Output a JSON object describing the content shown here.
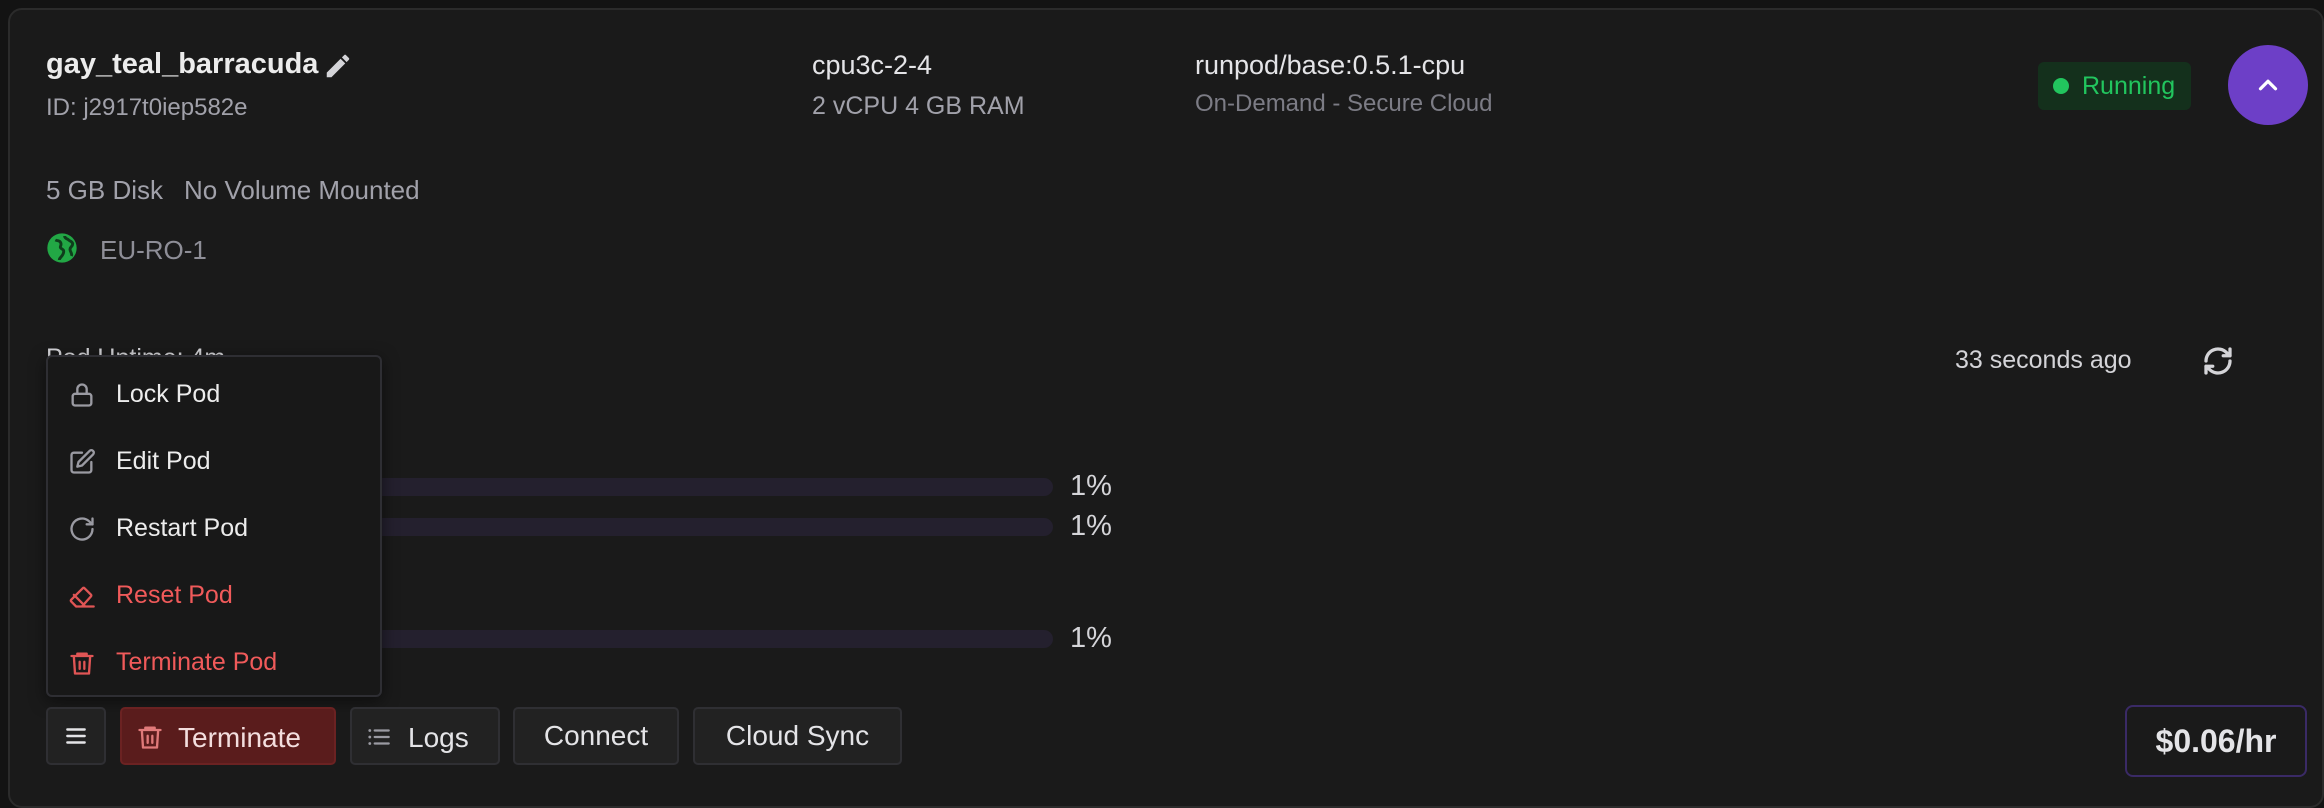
{
  "pod": {
    "name": "gay_teal_barracuda",
    "id_label": "ID: j2917t0iep582e",
    "gpu_type": "cpu3c-2-4",
    "gpu_spec": "2 vCPU 4 GB RAM",
    "image": "runpod/base:0.5.1-cpu",
    "image_sub": "On-Demand - Secure Cloud",
    "status": "Running",
    "disk": "5 GB Disk",
    "volume": "No Volume Mounted",
    "region": "EU-RO-1",
    "uptime": "Pod Uptime: 4m",
    "updated": "33 seconds ago",
    "price": "$0.06/hr"
  },
  "metrics": [
    {
      "percent_label": "1%",
      "value": 0.01
    },
    {
      "percent_label": "1%",
      "value": 0.01
    },
    {
      "percent_label": "1%",
      "value": 0.01
    }
  ],
  "menu": {
    "items": [
      {
        "label": "Lock Pod",
        "icon": "lock-icon"
      },
      {
        "label": "Edit Pod",
        "icon": "edit-icon"
      },
      {
        "label": "Restart Pod",
        "icon": "restart-icon"
      },
      {
        "label": "Reset Pod",
        "icon": "eraser-icon"
      },
      {
        "label": "Terminate Pod",
        "icon": "trash-icon"
      }
    ]
  },
  "actions": {
    "terminate": "Terminate",
    "logs": "Logs",
    "connect": "Connect",
    "cloud_sync": "Cloud Sync"
  },
  "colors": {
    "accent": "#6d3fc7",
    "running": "#22c55e",
    "danger": "#f05a5a"
  }
}
